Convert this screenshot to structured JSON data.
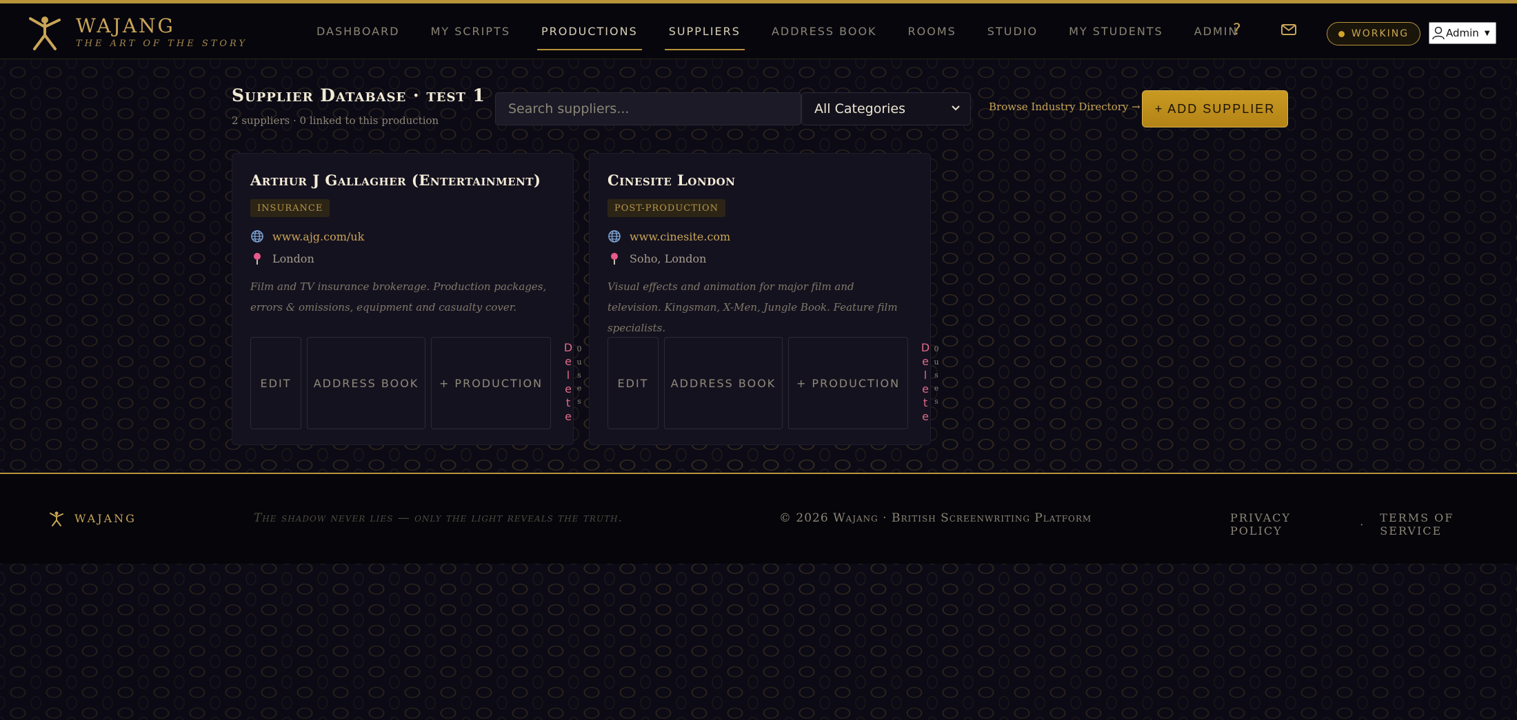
{
  "brand": {
    "name": "WAJANG",
    "tagline": "THE ART OF THE STORY",
    "accent_color": "#b8933a"
  },
  "nav": {
    "items": [
      {
        "label": "DASHBOARD",
        "active": false
      },
      {
        "label": "MY SCRIPTS",
        "active": false
      },
      {
        "label": "PRODUCTIONS",
        "active": true
      },
      {
        "label": "SUPPLIERS",
        "active": true
      },
      {
        "label": "ADDRESS BOOK",
        "active": false
      },
      {
        "label": "ROOMS",
        "active": false
      },
      {
        "label": "STUDIO",
        "active": false
      },
      {
        "label": "MY STUDENTS",
        "active": false
      },
      {
        "label": "ADMIN",
        "active": false
      }
    ],
    "help_label": "?",
    "mail_icon": "mail-icon",
    "status_label": "WORKING",
    "user_label": "Admin"
  },
  "header": {
    "title": "Supplier Database · test 1",
    "subtitle": "2 suppliers · 0 linked to this production",
    "search_placeholder": "Search suppliers...",
    "category_selected": "All Categories",
    "browse_label": "Browse Industry Directory →",
    "add_label": "+ ADD SUPPLIER"
  },
  "suppliers": [
    {
      "name": "Arthur J Gallagher (Entertainment)",
      "category": "INSURANCE",
      "website": "www.ajg.com/uk",
      "location": "London",
      "description": "Film and TV insurance brokerage. Production packages, errors & omissions, equipment and casualty cover.",
      "edit_label": "EDIT",
      "address_book_label": "ADDRESS BOOK",
      "production_label": "+ PRODUCTION",
      "delete_label": "Delete",
      "uses_label": "0 uses"
    },
    {
      "name": "Cinesite London",
      "category": "POST-PRODUCTION",
      "website": "www.cinesite.com",
      "location": "Soho, London",
      "description": "Visual effects and animation for major film and television. Kingsman, X-Men, Jungle Book. Feature film specialists.",
      "edit_label": "EDIT",
      "address_book_label": "ADDRESS BOOK",
      "production_label": "+ PRODUCTION",
      "delete_label": "Delete",
      "uses_label": "0 uses"
    }
  ],
  "footer": {
    "brand": "WAJANG",
    "quote": "The shadow never lies — only the light reveals the truth.",
    "copyright": "© 2026 Wajang · British Screenwriting Platform",
    "privacy_label": "PRIVACY POLICY",
    "separator": "·",
    "terms_label": "TERMS OF SERVICE"
  }
}
